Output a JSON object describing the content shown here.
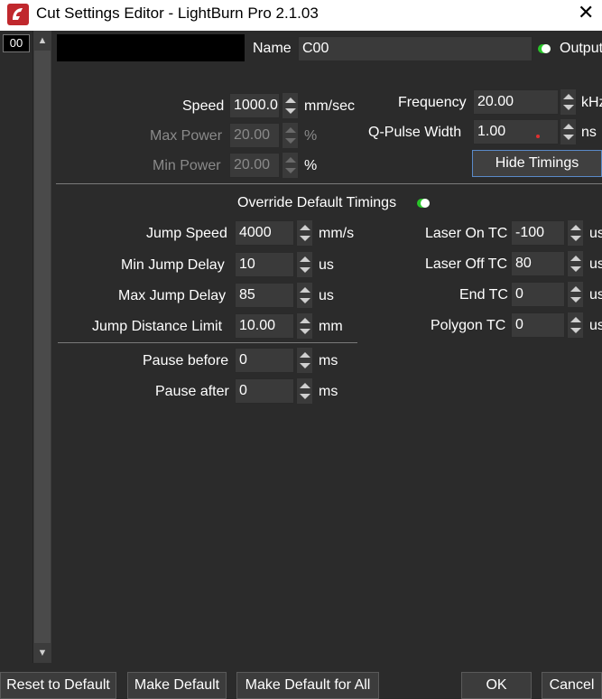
{
  "window": {
    "title": "Cut Settings Editor - LightBurn Pro 2.1.03",
    "close_glyph": "✕",
    "icon": "lightburn-logo-icon"
  },
  "layer": {
    "index": "00",
    "name_label": "Name",
    "name_value": "C00",
    "output_label": "Output",
    "output_on": true
  },
  "power": {
    "speed_label": "Speed",
    "speed_value": "1000.0",
    "speed_unit": "mm/sec",
    "max_power_label": "Max Power",
    "max_power_value": "20.00",
    "max_power_unit": "%",
    "min_power_label": "Min Power",
    "min_power_value": "20.00",
    "min_power_unit": "%"
  },
  "pulse": {
    "frequency_label": "Frequency",
    "frequency_value": "20.00",
    "frequency_unit": "kHz",
    "qpulse_label": "Q-Pulse Width",
    "qpulse_value": "1.00",
    "qpulse_unit": "ns",
    "hide_timings_label": "Hide Timings"
  },
  "timings": {
    "override_label": "Override Default Timings",
    "override_on": true,
    "jump_speed_label": "Jump Speed",
    "jump_speed_value": "4000",
    "jump_speed_unit": "mm/s",
    "min_jump_delay_label": "Min Jump Delay",
    "min_jump_delay_value": "10",
    "min_jump_delay_unit": "us",
    "max_jump_delay_label": "Max Jump Delay",
    "max_jump_delay_value": "85",
    "max_jump_delay_unit": "us",
    "jump_distance_label": "Jump Distance Limit",
    "jump_distance_value": "10.00",
    "jump_distance_unit": "mm",
    "laser_on_label": "Laser On TC",
    "laser_on_value": "-100",
    "laser_on_unit": "us",
    "laser_off_label": "Laser Off TC",
    "laser_off_value": "80",
    "laser_off_unit": "us",
    "end_tc_label": "End TC",
    "end_tc_value": "0",
    "end_tc_unit": "us",
    "polygon_tc_label": "Polygon TC",
    "polygon_tc_value": "0",
    "polygon_tc_unit": "us",
    "pause_before_label": "Pause before",
    "pause_before_value": "0",
    "pause_before_unit": "ms",
    "pause_after_label": "Pause after",
    "pause_after_value": "0",
    "pause_after_unit": "ms"
  },
  "footer": {
    "reset_label": "Reset to Default",
    "make_default_label": "Make Default",
    "make_default_all_label": "Make Default for All",
    "ok_label": "OK",
    "cancel_label": "Cancel"
  },
  "colors": {
    "background": "#2b2b2b",
    "field": "#3a3a3a",
    "toggle_on": "#29c529",
    "accent_border": "#5a8ac8"
  }
}
